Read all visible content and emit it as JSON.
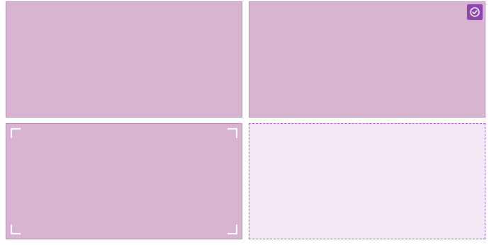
{
  "colors": {
    "card_fill": "#d8b4d2",
    "card_border": "#b88db3",
    "empty_fill": "#f4e8f7",
    "empty_border": "#a35ec0",
    "accent": "#8e44ad",
    "corner_marks": "#ffffff"
  },
  "cards": [
    {
      "state": "default"
    },
    {
      "state": "selected",
      "icon": "check-circle-icon"
    },
    {
      "state": "focused",
      "icon": "focus-corners-icon"
    },
    {
      "state": "empty-drop-zone"
    }
  ]
}
